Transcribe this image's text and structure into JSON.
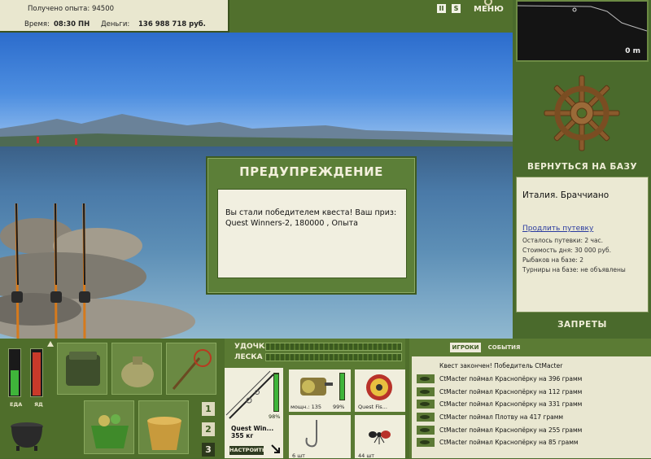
{
  "stats": {
    "experience_label": "Получено опыта:",
    "experience_value": "94500",
    "time_label": "Время:",
    "time_value": "08:30 ПН",
    "money_label": "Деньги:",
    "money_value": "136 988 718 руб."
  },
  "toolbar": {
    "pause_label": "II",
    "sound_label": "S",
    "menu_label": "МЕНЮ"
  },
  "depth_map": {
    "distance_label": "0 m"
  },
  "base": {
    "return_label": "ВЕРНУТЬСЯ НА БАЗУ",
    "location": "Италия. Браччиано",
    "extend_link": "Продлить путевку",
    "info": [
      "Осталось путевки: 2 час.",
      "Стоимость дня: 30 000 руб.",
      "Рыбаков на базе: 2",
      "Турниры на базе: не объявлены"
    ],
    "bans_label": "ЗАПРЕТЫ"
  },
  "dialog": {
    "title": "ПРЕДУПРЕЖДЕНИЕ",
    "message": "Вы стали победителем квеста! Ваш приз: Quest Winners-2, 180000 , Опыта"
  },
  "meters": {
    "food_label": "ЕДА",
    "poison_label": "ЯД"
  },
  "inventory": {
    "tabs": [
      "1",
      "2",
      "3"
    ]
  },
  "tackle": {
    "rod_label": "УДОЧКА",
    "line_label": "ЛЕСКА",
    "rod_percent": "98%",
    "rod_name": "Quest Win...",
    "rod_weight": "355 кг",
    "adjust_label": "НАСТРОИТЬ",
    "reel_caption": "мощн.: 135",
    "reel_percent": "99%",
    "line_caption": "Quest Fis...",
    "hook_caption": "6 шт",
    "bait_caption": "44 шт"
  },
  "events": {
    "tab_players": "ИГРОКИ",
    "tab_events": "СОБЫТИЯ",
    "quest_line": "Квест закончен! Победитель CtMacter",
    "log": [
      "CtMacter поймал Краснопёрку на 396 грамм",
      "CtMacter поймал Краснопёрку на 112 грамм",
      "CtMacter поймал Краснопёрку на 331 грамм",
      "CtMacter поймал Плотву на 417 грамм",
      "CtMacter поймал Краснопёрку на 255 грамм",
      "CtMacter поймал Краснопёрку на 85 грамм"
    ]
  },
  "levels": {
    "food": 0.55,
    "poison": 0.95,
    "rod_condition": 0.98,
    "reel_condition": 0.99
  },
  "colors": {
    "panel_green": "#4f6e2b",
    "panel_cream": "#ebe9d3",
    "food_meter": "#3fb43a",
    "poison_meter": "#c93a2a"
  }
}
